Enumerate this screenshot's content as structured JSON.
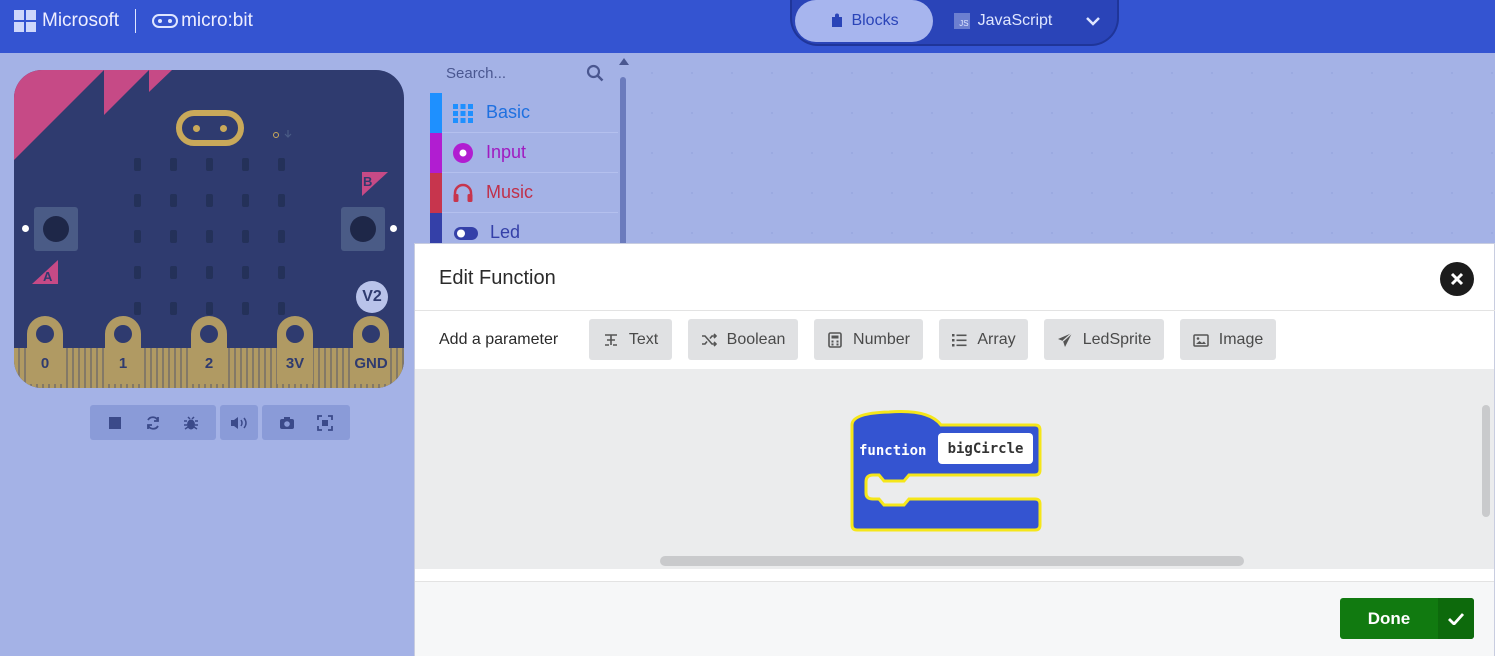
{
  "header": {
    "brand_microsoft": "Microsoft",
    "brand_microbit": "micro:bit",
    "editor_toggle": {
      "blocks": "Blocks",
      "javascript": "JavaScript",
      "js_badge": "JS"
    },
    "color": "#3454d1"
  },
  "simulator": {
    "buttons": {
      "a": "A",
      "b": "B"
    },
    "version_badge": "V2",
    "pins": [
      "0",
      "1",
      "2",
      "3V",
      "GND"
    ],
    "toolbar_icons": [
      "stop-icon",
      "restart-icon",
      "debug-icon",
      "sound-icon",
      "screenshot-icon",
      "fullscreen-icon"
    ]
  },
  "toolbox": {
    "search_placeholder": "Search...",
    "categories": [
      {
        "label": "Basic",
        "color": "#1e90ff"
      },
      {
        "label": "Input",
        "color": "#b11dd1"
      },
      {
        "label": "Music",
        "color": "#c7354d"
      },
      {
        "label": "Led",
        "color": "#3440a8"
      }
    ]
  },
  "modal": {
    "title": "Edit Function",
    "add_parameter_label": "Add a parameter",
    "parameter_types": [
      "Text",
      "Boolean",
      "Number",
      "Array",
      "LedSprite",
      "Image"
    ],
    "block": {
      "keyword": "function",
      "name": "bigCircle"
    },
    "done_label": "Done"
  }
}
